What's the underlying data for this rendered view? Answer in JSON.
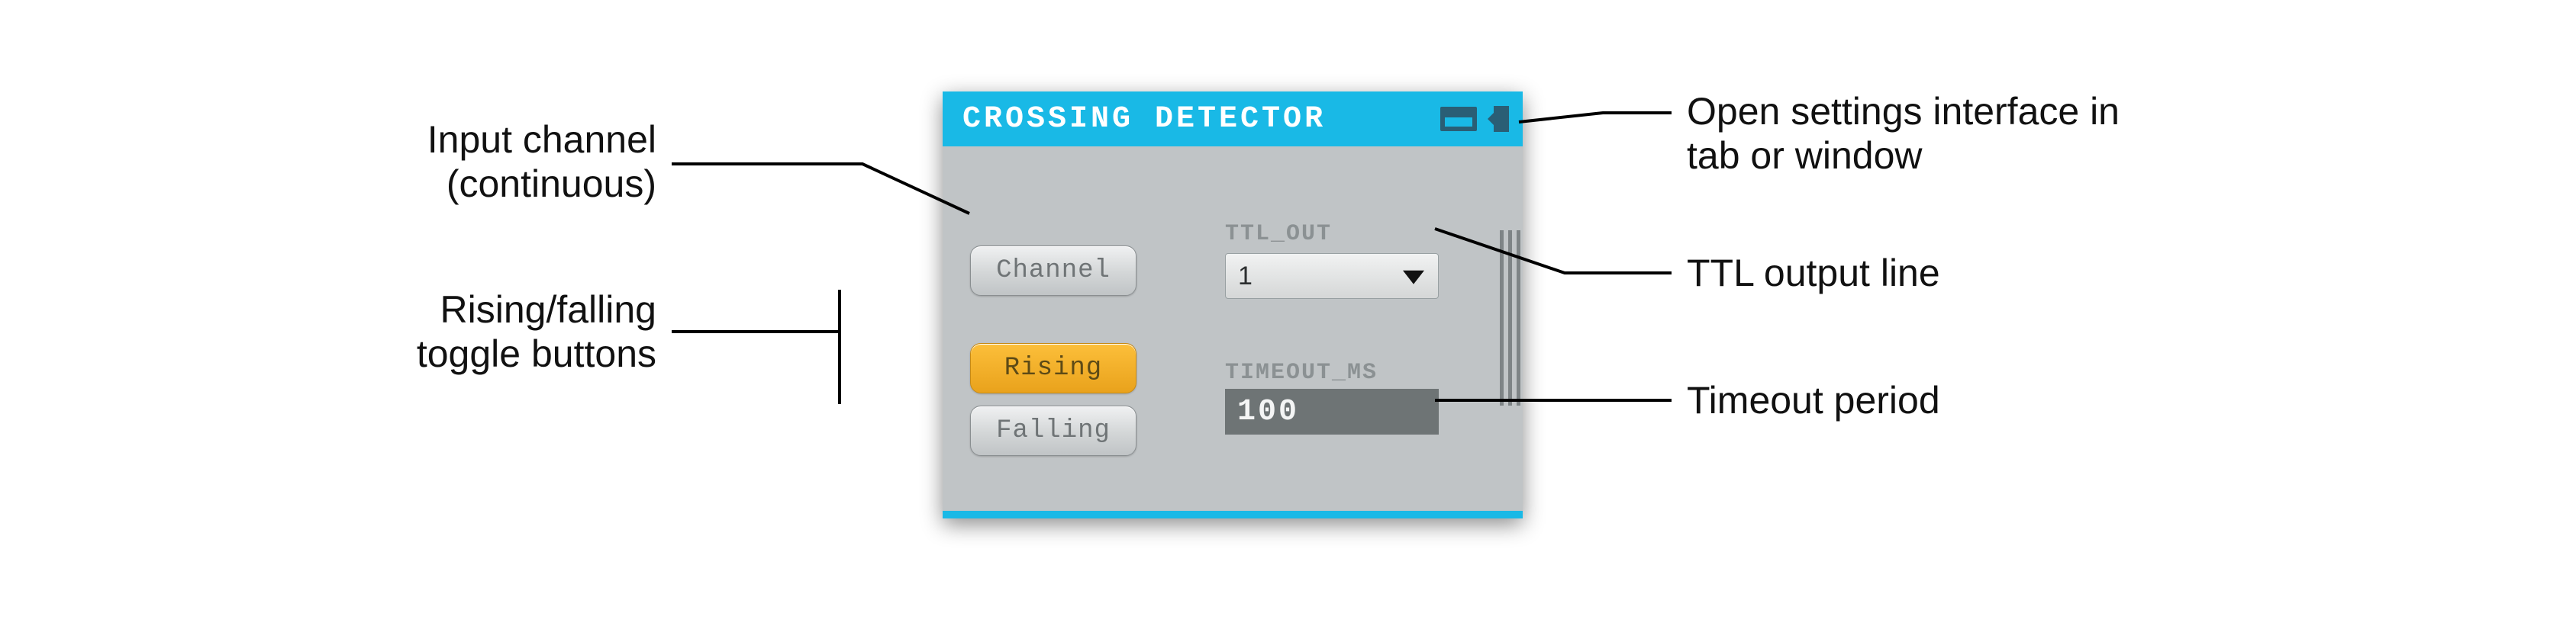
{
  "panel": {
    "title": "CROSSING  DETECTOR",
    "channel_button_label": "Channel",
    "rising_button_label": "Rising",
    "falling_button_label": "Falling",
    "ttl_out_label": "TTL_OUT",
    "ttl_out_value": "1",
    "timeout_label": "TIMEOUT_MS",
    "timeout_value": "100"
  },
  "annotations": {
    "input_channel_line1": "Input channel",
    "input_channel_line2": "(continuous)",
    "toggle_line1": "Rising/falling",
    "toggle_line2": "toggle buttons",
    "settings_line1": "Open settings interface in",
    "settings_line2": "tab or window",
    "ttl_out": "TTL output line",
    "timeout": "Timeout period"
  }
}
